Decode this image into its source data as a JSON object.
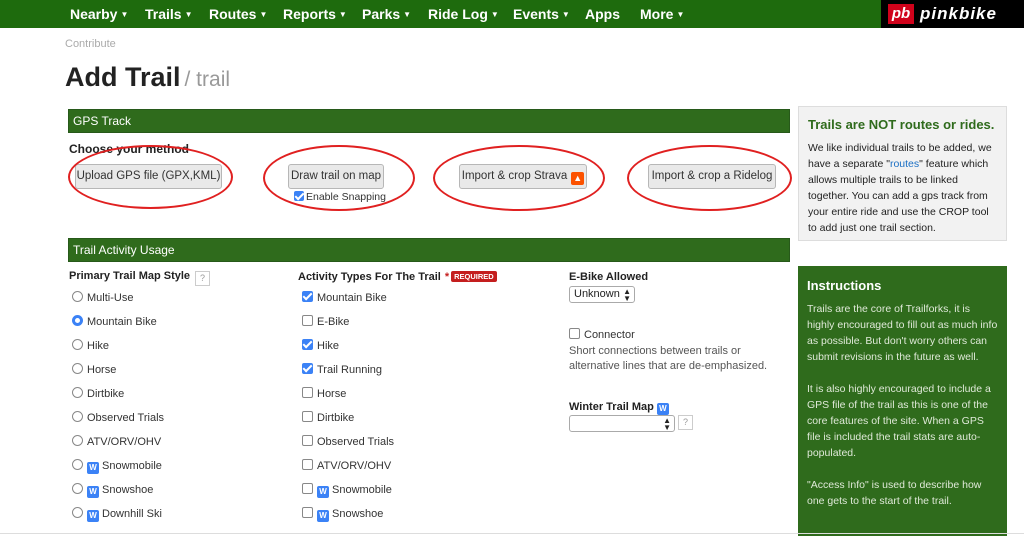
{
  "nav": {
    "items": [
      {
        "label": "Nearby",
        "caret": "▼"
      },
      {
        "label": "Trails",
        "caret": "▼"
      },
      {
        "label": "Routes",
        "caret": "▼"
      },
      {
        "label": "Reports",
        "caret": "▼"
      },
      {
        "label": "Parks",
        "caret": "▼"
      },
      {
        "label": "Ride Log",
        "caret": "▼"
      },
      {
        "label": "Events",
        "caret": "▼"
      },
      {
        "label": "Apps",
        "caret": ""
      },
      {
        "label": "More",
        "caret": "▼"
      }
    ],
    "logo_mark": "pb",
    "logo_word": "pinkbike"
  },
  "breadcrumb": "Contribute",
  "title": {
    "main": "Add Trail",
    "sub": "/ trail"
  },
  "gps": {
    "header": "GPS Track",
    "method_label": "Choose your method",
    "buttons": {
      "upload": "Upload GPS file (GPX,KML)",
      "draw": "Draw trail on map",
      "strava": "Import & crop Strava",
      "ridelog": "Import & crop a Ridelog"
    },
    "snapping_label": "Enable Snapping",
    "snapping_checked": true
  },
  "usage": {
    "header": "Trail Activity Usage",
    "map_style": {
      "label": "Primary Trail Map Style",
      "help": "?",
      "options": [
        {
          "label": "Multi-Use",
          "selected": false,
          "winter": false
        },
        {
          "label": "Mountain Bike",
          "selected": true,
          "winter": false
        },
        {
          "label": "Hike",
          "selected": false,
          "winter": false
        },
        {
          "label": "Horse",
          "selected": false,
          "winter": false
        },
        {
          "label": "Dirtbike",
          "selected": false,
          "winter": false
        },
        {
          "label": "Observed Trials",
          "selected": false,
          "winter": false
        },
        {
          "label": "ATV/ORV/OHV",
          "selected": false,
          "winter": false
        },
        {
          "label": "Snowmobile",
          "selected": false,
          "winter": true
        },
        {
          "label": "Snowshoe",
          "selected": false,
          "winter": true
        },
        {
          "label": "Downhill Ski",
          "selected": false,
          "winter": true
        }
      ]
    },
    "activity_types": {
      "label": "Activity Types For The Trail",
      "required_star": "*",
      "required_badge": "REQUIRED",
      "options": [
        {
          "label": "Mountain Bike",
          "checked": true,
          "winter": false
        },
        {
          "label": "E-Bike",
          "checked": false,
          "winter": false
        },
        {
          "label": "Hike",
          "checked": true,
          "winter": false
        },
        {
          "label": "Trail Running",
          "checked": true,
          "winter": false
        },
        {
          "label": "Horse",
          "checked": false,
          "winter": false
        },
        {
          "label": "Dirtbike",
          "checked": false,
          "winter": false
        },
        {
          "label": "Observed Trials",
          "checked": false,
          "winter": false
        },
        {
          "label": "ATV/ORV/OHV",
          "checked": false,
          "winter": false
        },
        {
          "label": "Snowmobile",
          "checked": false,
          "winter": true
        },
        {
          "label": "Snowshoe",
          "checked": false,
          "winter": true
        }
      ]
    },
    "ebike": {
      "label": "E-Bike Allowed",
      "value": "Unknown"
    },
    "connector": {
      "label": "Connector",
      "checked": false,
      "description": "Short connections between trails or alternative lines that are de-emphasized."
    },
    "winter_map": {
      "label": "Winter Trail Map",
      "badge": "W",
      "value": "",
      "help": "?"
    },
    "winter_badge": "W"
  },
  "note": {
    "title": "Trails are NOT routes or rides.",
    "text_before": "We like individual trails to be added, we have a separate \"",
    "link": "routes",
    "text_after": "\" feature which allows multiple trails to be linked together. You can add a gps track from your entire ride and use the CROP tool to add just one trail section."
  },
  "instructions": {
    "title": "Instructions",
    "paragraphs": [
      "Trails are the core of Trailforks, it is highly encouraged to fill out as much info as possible. But don't worry others can submit revisions in the future as well.",
      "It is also highly encouraged to include a GPS file of the trail as this is one of the core features of the site. When a GPS file is included the trail stats are auto-populated.",
      "\"Access Info\" is used to describe how one gets to the start of the trail."
    ]
  },
  "colors": {
    "nav_green": "#1e6b0d",
    "section_green": "#2f6b1c",
    "accent_blue": "#3b82f6",
    "required_red": "#c41e1e",
    "annotation_red": "#e02020"
  }
}
